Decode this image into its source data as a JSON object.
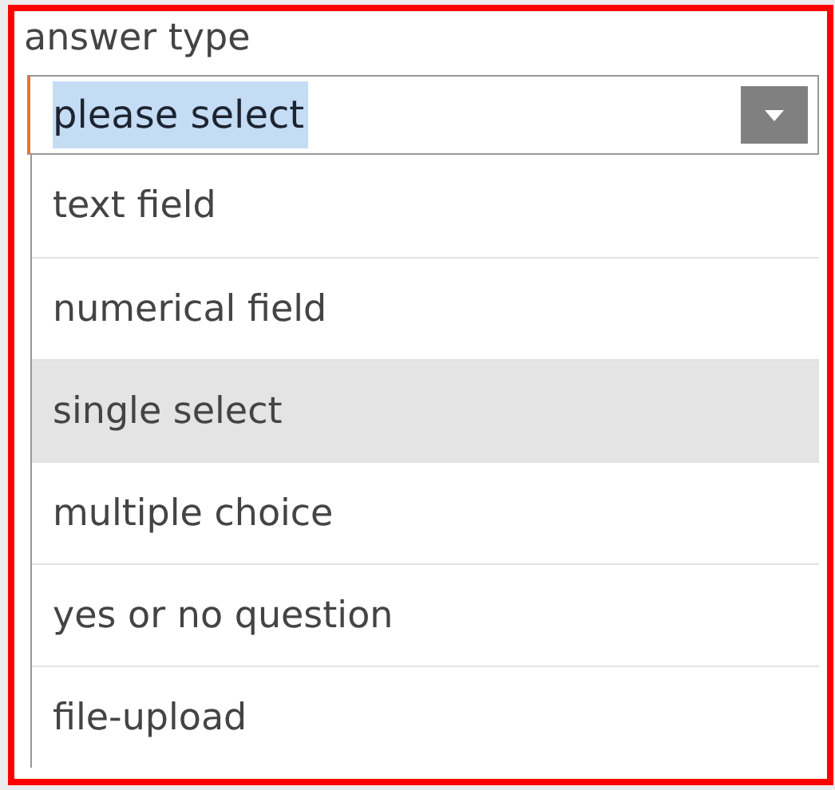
{
  "label": "answer type",
  "select": {
    "value": "please select",
    "value_highlighted": true
  },
  "options": [
    {
      "label": "text field",
      "selected": false
    },
    {
      "label": "numerical field",
      "selected": false
    },
    {
      "label": "single select",
      "selected": true
    },
    {
      "label": "multiple choice",
      "selected": false
    },
    {
      "label": "yes or no question",
      "selected": false
    },
    {
      "label": "file-upload",
      "selected": false
    }
  ]
}
